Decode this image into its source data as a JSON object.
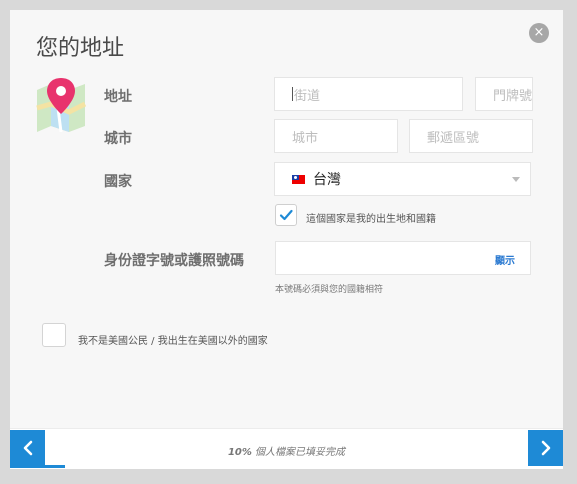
{
  "dialog": {
    "title": "您的地址",
    "close_glyph": "×",
    "icon": "map-pin-icon"
  },
  "address": {
    "label": "地址",
    "street_placeholder": "街道",
    "number_placeholder": "門牌號"
  },
  "city": {
    "label": "城市",
    "city_placeholder": "城市",
    "postal_placeholder": "郵遞區號"
  },
  "country": {
    "label": "國家",
    "selected": "台灣",
    "flag_icon": "taiwan-flag-icon",
    "birth_check_label": "這個國家是我的出生地和國籍",
    "birth_checked": true
  },
  "id_number": {
    "label": "身份證字號或護照號碼",
    "show_label": "顯示",
    "hint": "本號碼必須與您的國籍相符"
  },
  "non_us": {
    "label": "我不是美國公民 / 我出生在美國以外的國家",
    "checked": false
  },
  "footer": {
    "progress_percent": "10%",
    "progress_text": " 個人檔案已填妥完成",
    "progress_fraction": 0.1,
    "prev_icon": "chevron-left-icon",
    "next_icon": "chevron-right-icon"
  },
  "colors": {
    "accent": "#1e8ad6",
    "background": "#f7f7f7",
    "pin": "#e8336d"
  }
}
